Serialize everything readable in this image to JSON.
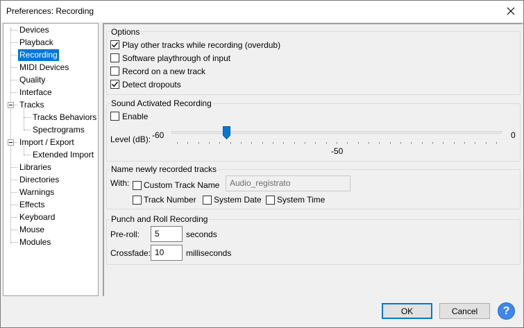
{
  "window": {
    "title": "Preferences: Recording"
  },
  "tree": {
    "items": [
      {
        "label": "Devices"
      },
      {
        "label": "Playback"
      },
      {
        "label": "Recording"
      },
      {
        "label": "MIDI Devices"
      },
      {
        "label": "Quality"
      },
      {
        "label": "Interface"
      },
      {
        "label": "Tracks"
      },
      {
        "label": "Tracks Behaviors"
      },
      {
        "label": "Spectrograms"
      },
      {
        "label": "Import / Export"
      },
      {
        "label": "Extended Import"
      },
      {
        "label": "Libraries"
      },
      {
        "label": "Directories"
      },
      {
        "label": "Warnings"
      },
      {
        "label": "Effects"
      },
      {
        "label": "Keyboard"
      },
      {
        "label": "Mouse"
      },
      {
        "label": "Modules"
      }
    ],
    "selected": "Recording"
  },
  "options": {
    "title": "Options",
    "overdub": {
      "label": "Play other tracks while recording (overdub)",
      "checked": true
    },
    "software_playthrough": {
      "label": "Software playthrough of input",
      "checked": false
    },
    "new_track": {
      "label": "Record on a new track",
      "checked": false
    },
    "detect_dropouts": {
      "label": "Detect dropouts",
      "checked": true
    }
  },
  "sound_activated": {
    "title": "Sound Activated Recording",
    "enable": {
      "label": "Enable",
      "checked": false
    },
    "level_label": "Level (dB):",
    "min_label": "-60",
    "max_label": "0",
    "value_label": "-50",
    "value": -50,
    "min": -60,
    "max": 0
  },
  "naming": {
    "title": "Name newly recorded tracks",
    "with_label": "With:",
    "custom_name": {
      "label": "Custom Track Name",
      "checked": false
    },
    "custom_name_value": "Audio_registrato",
    "track_number": {
      "label": "Track Number",
      "checked": false
    },
    "system_date": {
      "label": "System Date",
      "checked": false
    },
    "system_time": {
      "label": "System Time",
      "checked": false
    }
  },
  "punch_roll": {
    "title": "Punch and Roll Recording",
    "preroll_label": "Pre-roll:",
    "preroll_value": "5",
    "preroll_unit": "seconds",
    "crossfade_label": "Crossfade:",
    "crossfade_value": "10",
    "crossfade_unit": "milliseconds"
  },
  "buttons": {
    "ok": "OK",
    "cancel": "Cancel",
    "help": "?"
  },
  "colors": {
    "accent": "#0078d7",
    "help": "#3f87e8",
    "selection": "#0078d7"
  },
  "icons": {
    "close": "close-icon",
    "checkmark": "checkmark-icon",
    "help": "help-icon",
    "collapse": "collapse-icon"
  }
}
